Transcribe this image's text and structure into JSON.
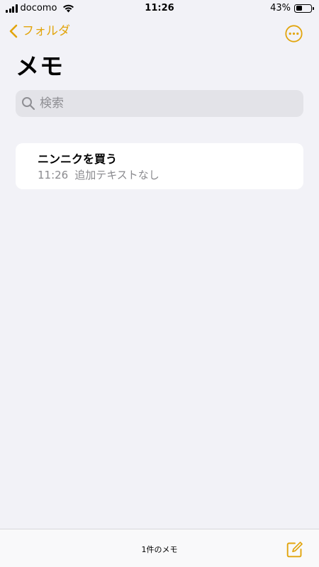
{
  "status_bar": {
    "carrier": "docomo",
    "time": "11:26",
    "battery_percent": "43%",
    "battery_level": 0.43
  },
  "nav": {
    "back_label": "フォルダ",
    "more_icon": "ellipsis-circle-icon"
  },
  "page": {
    "title": "メモ"
  },
  "search": {
    "placeholder": "検索"
  },
  "notes": [
    {
      "title": "ニンニクを買う",
      "time": "11:26",
      "preview": "追加テキストなし"
    }
  ],
  "toolbar": {
    "count_label": "1件のメモ",
    "compose_icon": "compose-icon"
  },
  "colors": {
    "accent": "#e2a50d",
    "background": "#f2f2f7",
    "search_bg": "#e3e3e8",
    "secondary_text": "#8a8a8e"
  }
}
